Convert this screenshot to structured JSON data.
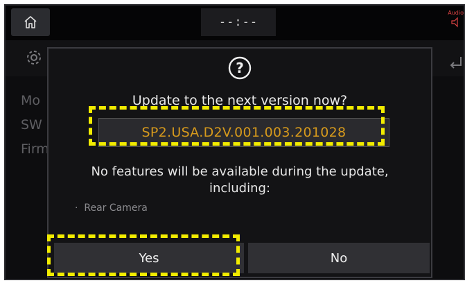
{
  "statusbar": {
    "clock": "--:--",
    "audio_label": "Audio"
  },
  "background_screen": {
    "items": [
      "Mo",
      "SW",
      "Firm"
    ]
  },
  "dialog": {
    "title": "Update to the next version now?",
    "version": "SP2.USA.D2V.001.003.201028",
    "message_line1": "No features will be available during the update,",
    "message_line2": "including:",
    "feature_list": [
      "Rear Camera"
    ],
    "yes_label": "Yes",
    "no_label": "No"
  },
  "colors": {
    "version_text": "#d79a1c",
    "highlight": "#f2ec00",
    "background": "#0d0d0f"
  },
  "icons": {
    "home": "home-icon",
    "settings": "gear-icon",
    "back": "back-arrow-icon",
    "question": "question-circle-icon",
    "audio": "speaker-icon"
  }
}
